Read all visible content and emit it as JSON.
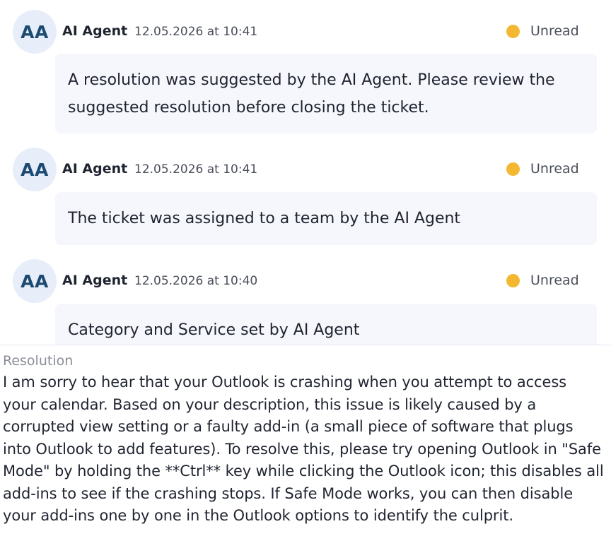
{
  "feed": {
    "entries": [
      {
        "avatar": "AA",
        "author": "AI Agent",
        "timestamp": "12.05.2026 at 10:41",
        "status": "Unread",
        "message": "A resolution was suggested by the AI Agent. Please review the suggested resolution before closing the ticket."
      },
      {
        "avatar": "AA",
        "author": "AI Agent",
        "timestamp": "12.05.2026 at 10:41",
        "status": "Unread",
        "message": "The ticket was assigned to a team by the AI Agent"
      },
      {
        "avatar": "AA",
        "author": "AI Agent",
        "timestamp": "12.05.2026 at 10:40",
        "status": "Unread",
        "message": "Category and Service set by AI Agent"
      }
    ]
  },
  "resolution": {
    "label": "Resolution",
    "text": "I am sorry to hear that your Outlook is crashing when you attempt to access your calendar. Based on your description, this issue is likely caused by a corrupted view setting or a faulty add-in (a small piece of software that plugs into Outlook to add features). To resolve this, please try opening Outlook in \"Safe Mode\" by holding the **Ctrl** key while clicking the Outlook icon; this disables all add-ins to see if the crashing stops. If Safe Mode works, you can then disable your add-ins one by one in the Outlook options to identify the culprit."
  },
  "colors": {
    "unread_dot": "#f4b731",
    "avatar_bg": "#e8eef9",
    "avatar_text": "#1c4a72",
    "bubble_bg": "#f5f7fc"
  }
}
